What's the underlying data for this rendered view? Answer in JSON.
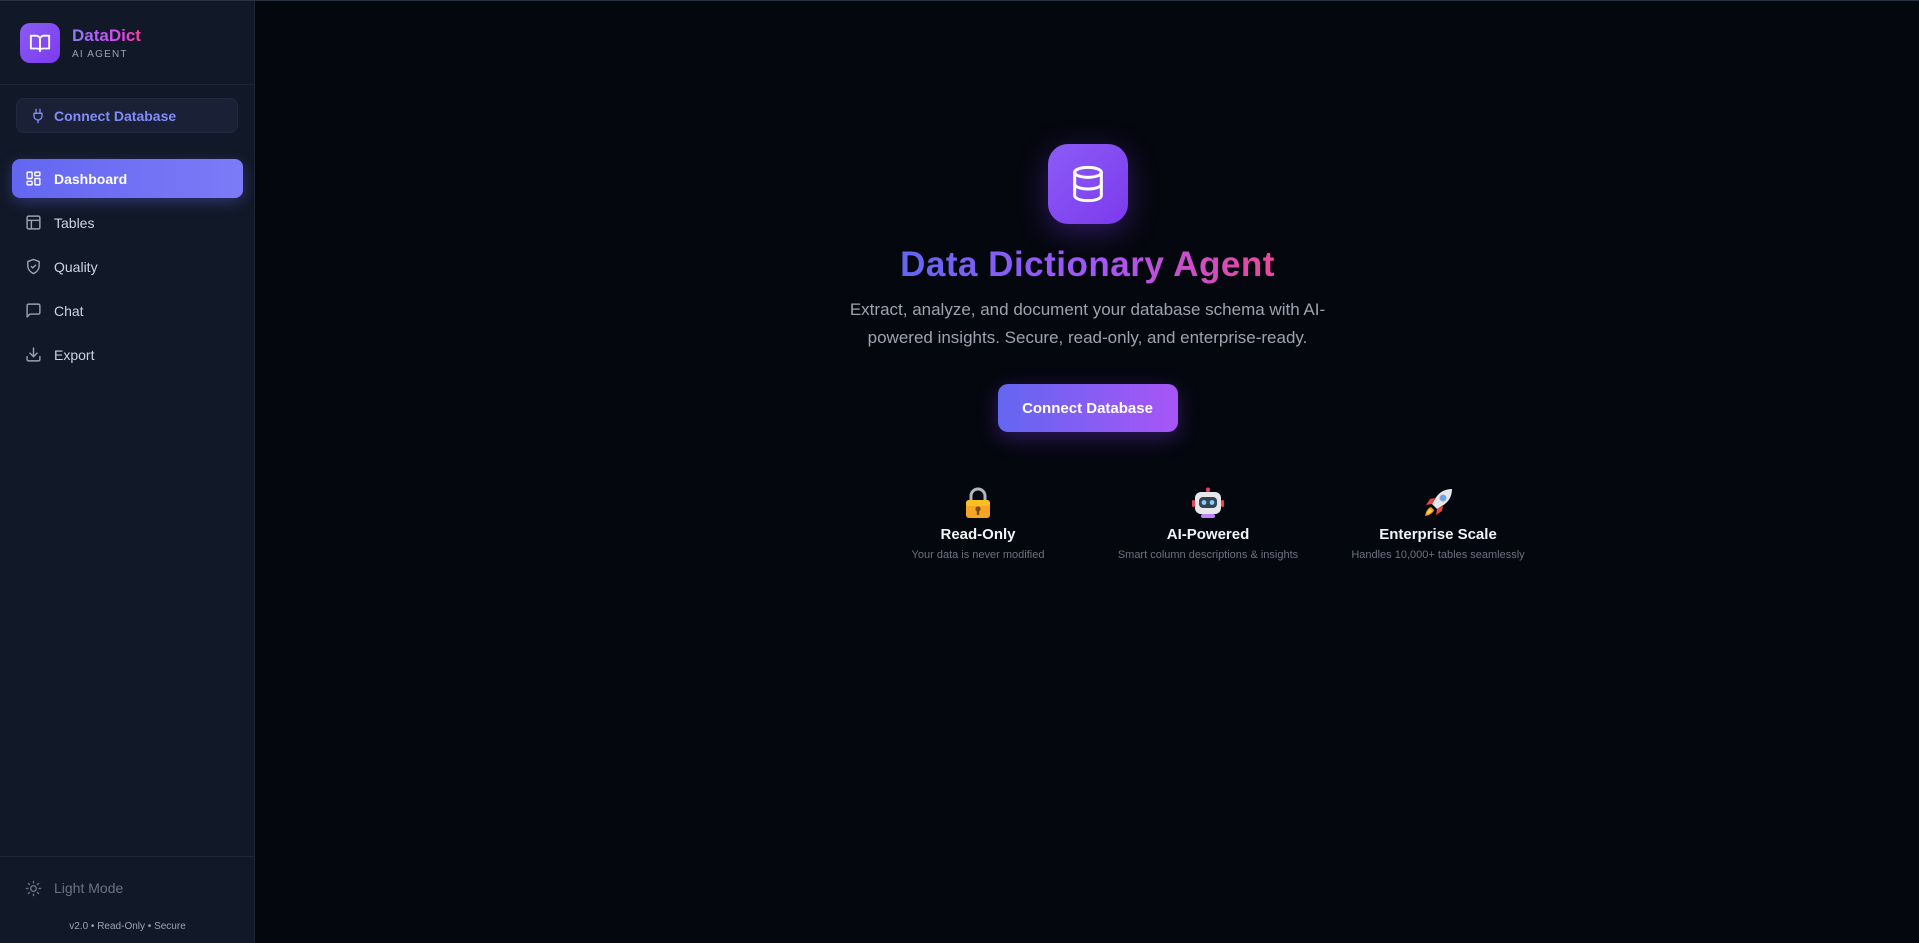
{
  "brand": {
    "name": "DataDict",
    "subtitle": "AI AGENT"
  },
  "sidebar": {
    "connect_label": "Connect Database",
    "items": [
      {
        "label": "Dashboard",
        "icon": "dashboard-icon",
        "active": true
      },
      {
        "label": "Tables",
        "icon": "table-icon",
        "active": false
      },
      {
        "label": "Quality",
        "icon": "shield-check-icon",
        "active": false
      },
      {
        "label": "Chat",
        "icon": "chat-icon",
        "active": false
      },
      {
        "label": "Export",
        "icon": "download-icon",
        "active": false
      }
    ],
    "light_mode_label": "Light Mode",
    "version": "v2.0 • Read-Only • Secure"
  },
  "hero": {
    "icon": "database-icon",
    "title": "Data Dictionary Agent",
    "description": "Extract, analyze, and document your database schema with AI-powered insights. Secure, read-only, and enterprise-ready.",
    "button_label": "Connect Database"
  },
  "features": [
    {
      "icon": "lock-icon",
      "title": "Read-Only",
      "description": "Your data is never modified"
    },
    {
      "icon": "robot-icon",
      "title": "AI-Powered",
      "description": "Smart column descriptions & insights"
    },
    {
      "icon": "rocket-icon",
      "title": "Enterprise Scale",
      "description": "Handles 10,000+ tables seamlessly"
    }
  ],
  "colors": {
    "background": "#05070f",
    "sidebar": "#111827",
    "accent": "#6366f1",
    "accent_purple": "#a855f7",
    "accent_pink": "#ec4899"
  }
}
